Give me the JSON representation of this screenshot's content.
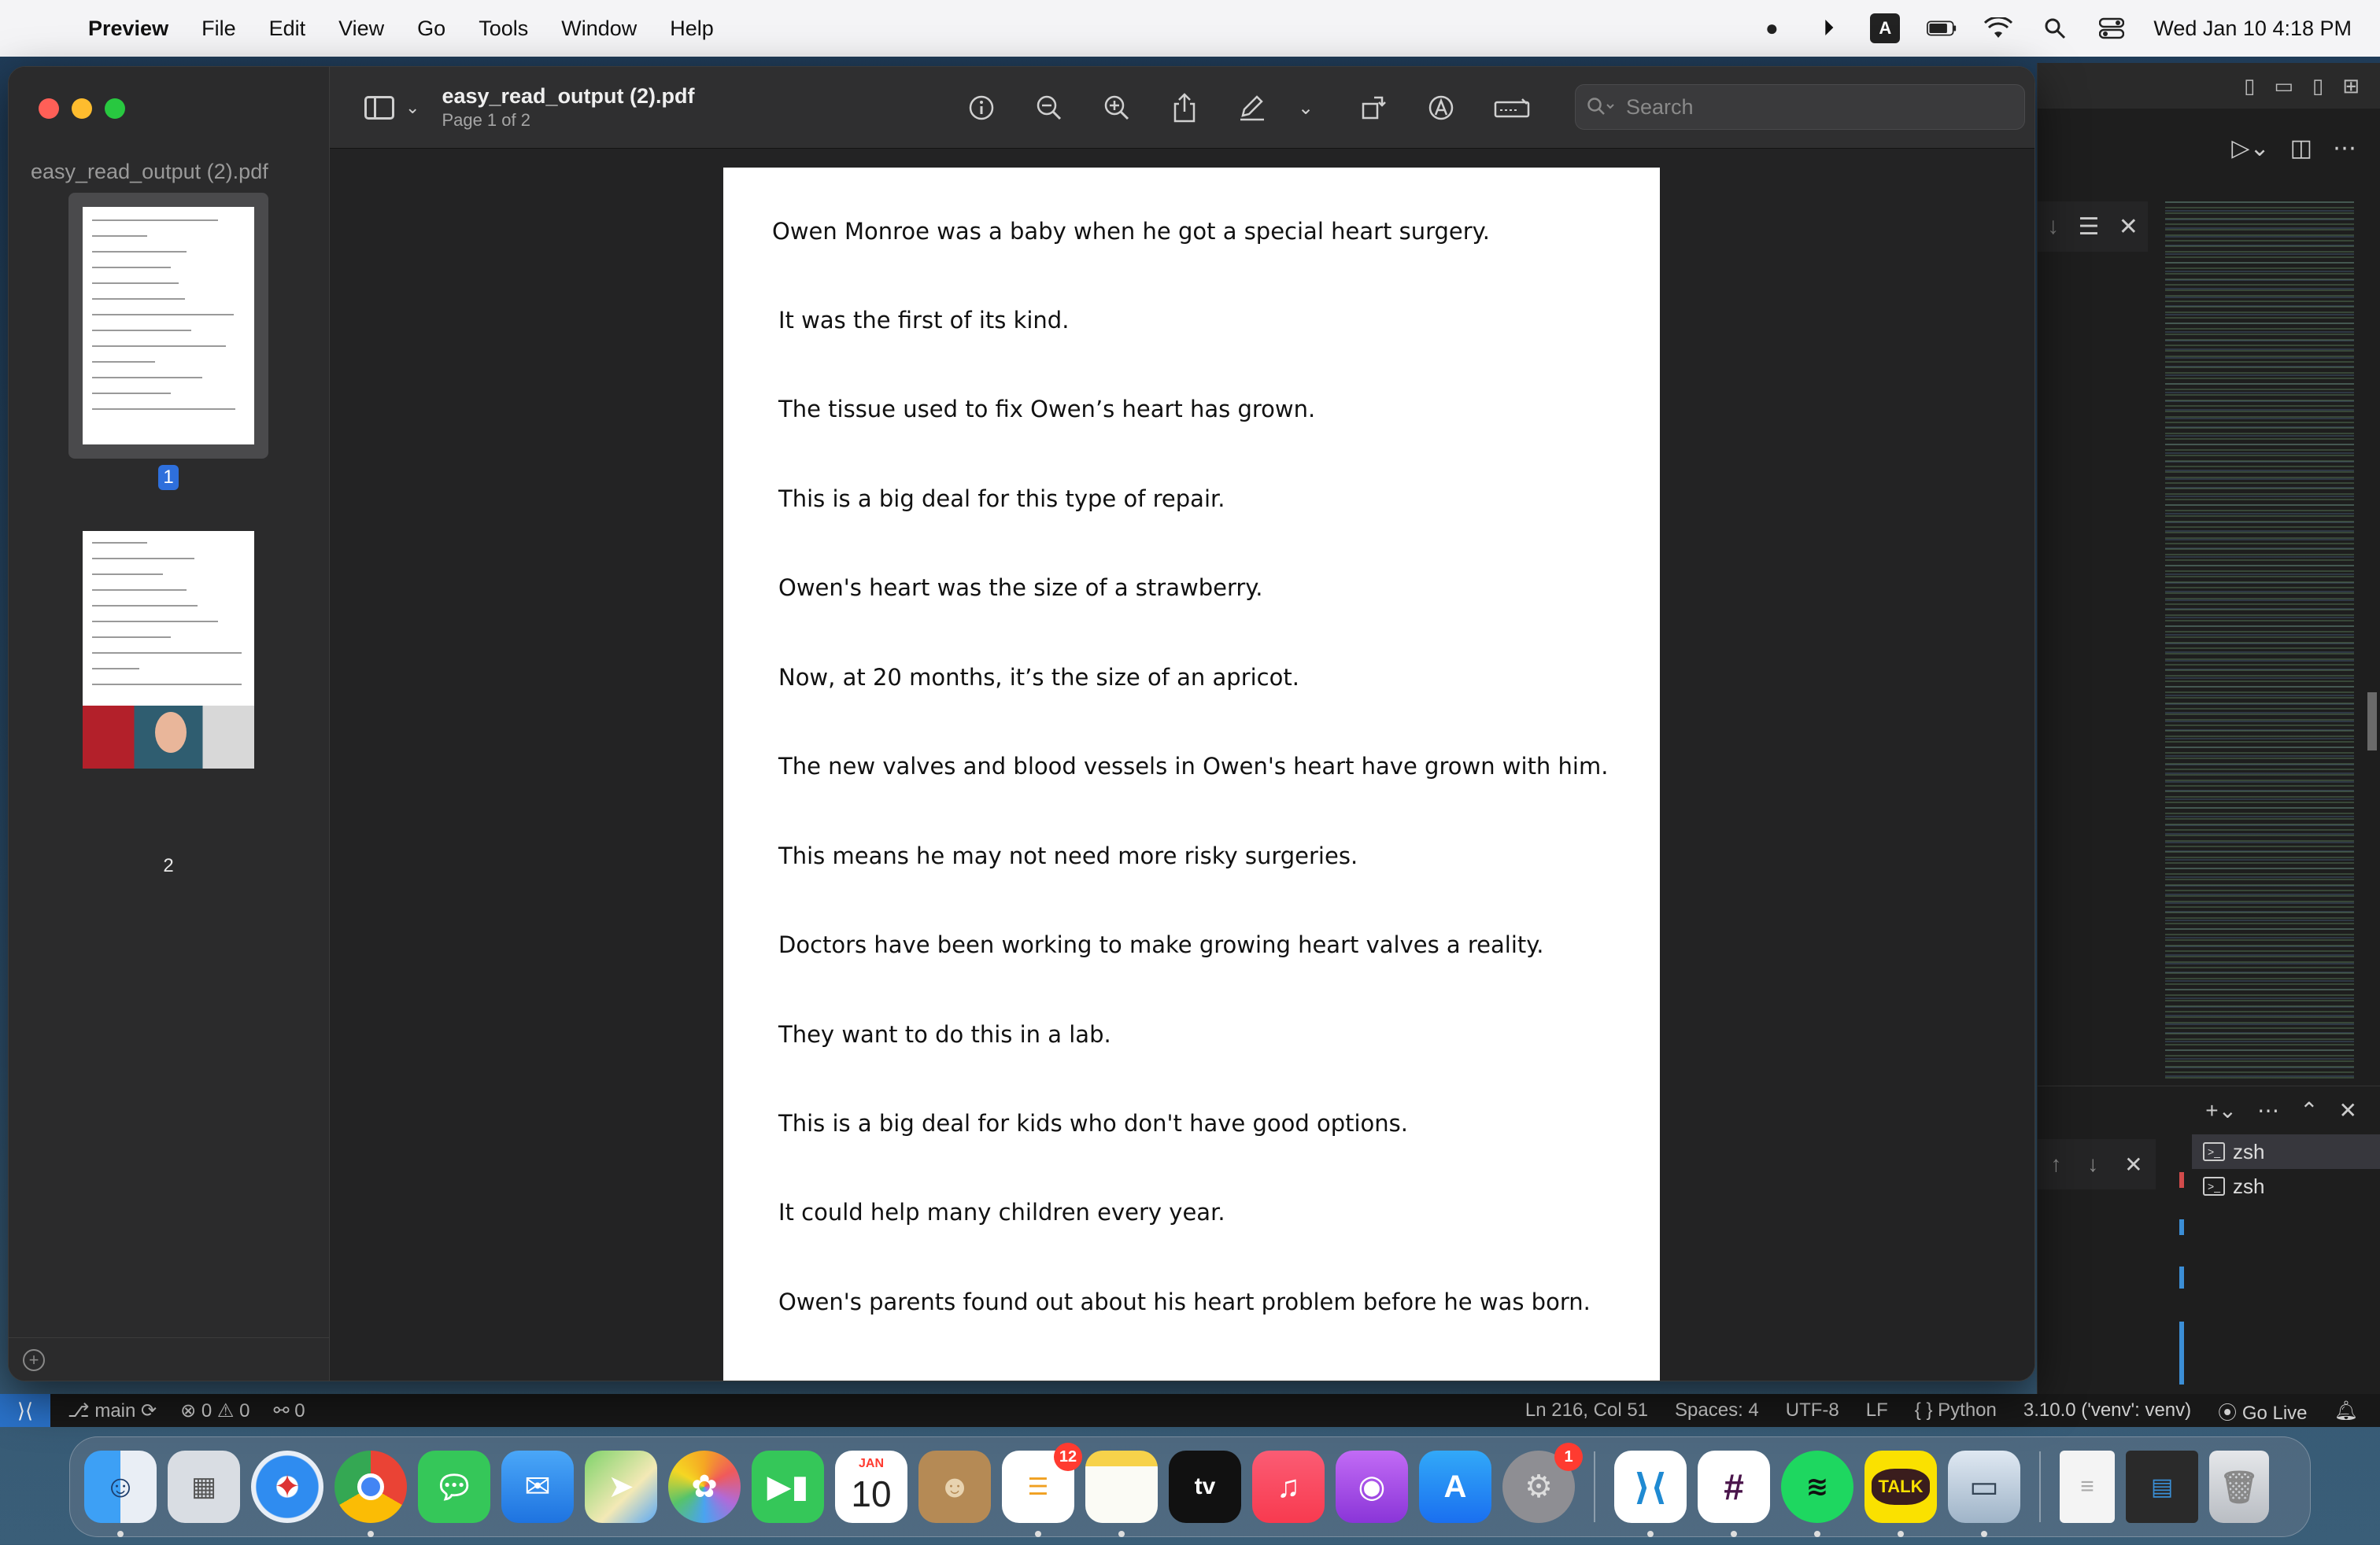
{
  "menubar": {
    "apple": "",
    "app_name": "Preview",
    "items": [
      "File",
      "Edit",
      "View",
      "Go",
      "Tools",
      "Window",
      "Help"
    ],
    "input_badge": "A",
    "clock": "Wed Jan 10  4:18 PM"
  },
  "preview": {
    "sidebar": {
      "doc_name": "easy_read_output (2).pdf",
      "page1_num": "1",
      "page2_num": "2"
    },
    "toolbar": {
      "title": "easy_read_output (2).pdf",
      "subtitle": "Page 1 of 2",
      "search_placeholder": "Search"
    },
    "page": {
      "paragraphs": [
        "Owen Monroe was a baby when he got a special heart surgery.",
        "It was the first of its kind.",
        "The tissue used to fix Owen’s heart has grown.",
        "This is a big deal for this type of repair.",
        "Owen's heart was the size of a strawberry.",
        "Now, at 20 months, it’s the size of an apricot.",
        "The new valves and blood vessels in Owen's heart have grown with him.",
        "This means he may not need more risky surgeries.",
        "Doctors have been working to make growing heart valves a reality.",
        "They want to do this in a lab.",
        "This is a big deal for kids who don't have good options.",
        "It could help many children every year.",
        "Owen's parents found out about his heart problem before he was born."
      ]
    }
  },
  "vscode": {
    "terminals": [
      "zsh",
      "zsh"
    ]
  },
  "statusbar": {
    "branch": "main",
    "problems": "⊗ 0  ⚠ 0",
    "ports": "0",
    "position": "Ln 216, Col 51",
    "spaces": "Spaces: 4",
    "encoding": "UTF-8",
    "eol": "LF",
    "language": "Python",
    "interpreter": "3.10.0 ('venv': venv)",
    "golive": "Go Live"
  },
  "dock": {
    "reminders_badge": "12",
    "settings_badge": "1",
    "calendar_month": "JAN",
    "calendar_day": "10",
    "tv_label": "tv",
    "talk_label": "TALK"
  }
}
